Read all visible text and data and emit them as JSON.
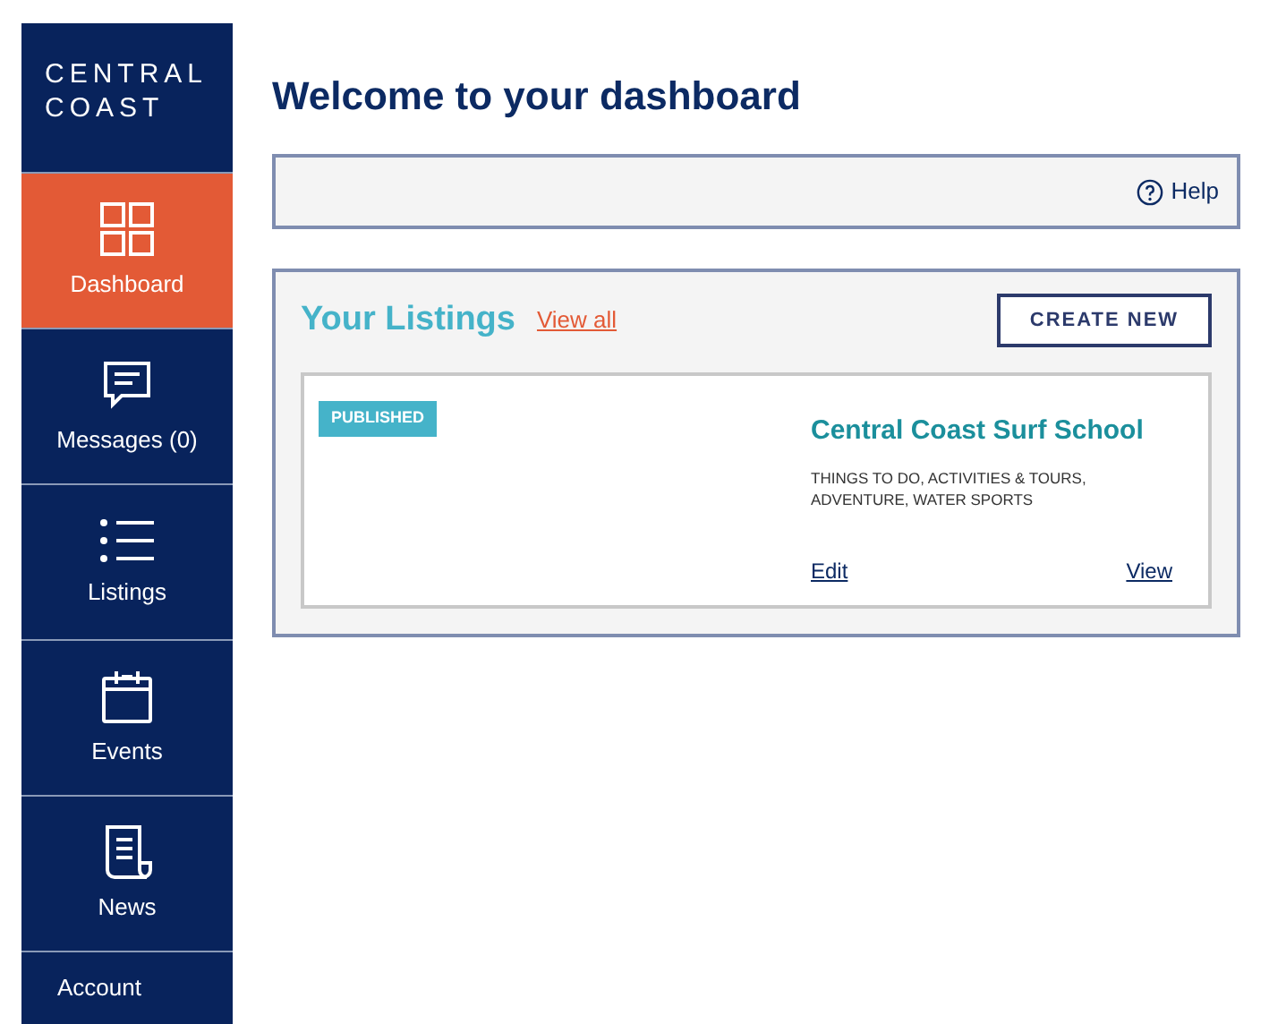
{
  "sidebar": {
    "logo": [
      "CENTRAL",
      "COAST"
    ],
    "items": [
      {
        "label": "Dashboard",
        "selected": true
      },
      {
        "label": "Messages (0)",
        "selected": false
      },
      {
        "label": "Listings",
        "selected": false
      },
      {
        "label": "Events",
        "selected": false
      },
      {
        "label": "News",
        "selected": false
      },
      {
        "label": "Account",
        "selected": false
      }
    ]
  },
  "title": "Welcome to your dashboard",
  "help": "Help",
  "listings": {
    "title": "Your Listings",
    "view_all": "View all",
    "create": "CREATE NEW",
    "cards": [
      {
        "status": "PUBLISHED",
        "name": "Central Coast Surf School",
        "categories": "THINGS TO DO, ACTIVITIES & TOURS, ADVENTURE, WATER SPORTS",
        "edit": "Edit",
        "view": "View"
      }
    ]
  }
}
